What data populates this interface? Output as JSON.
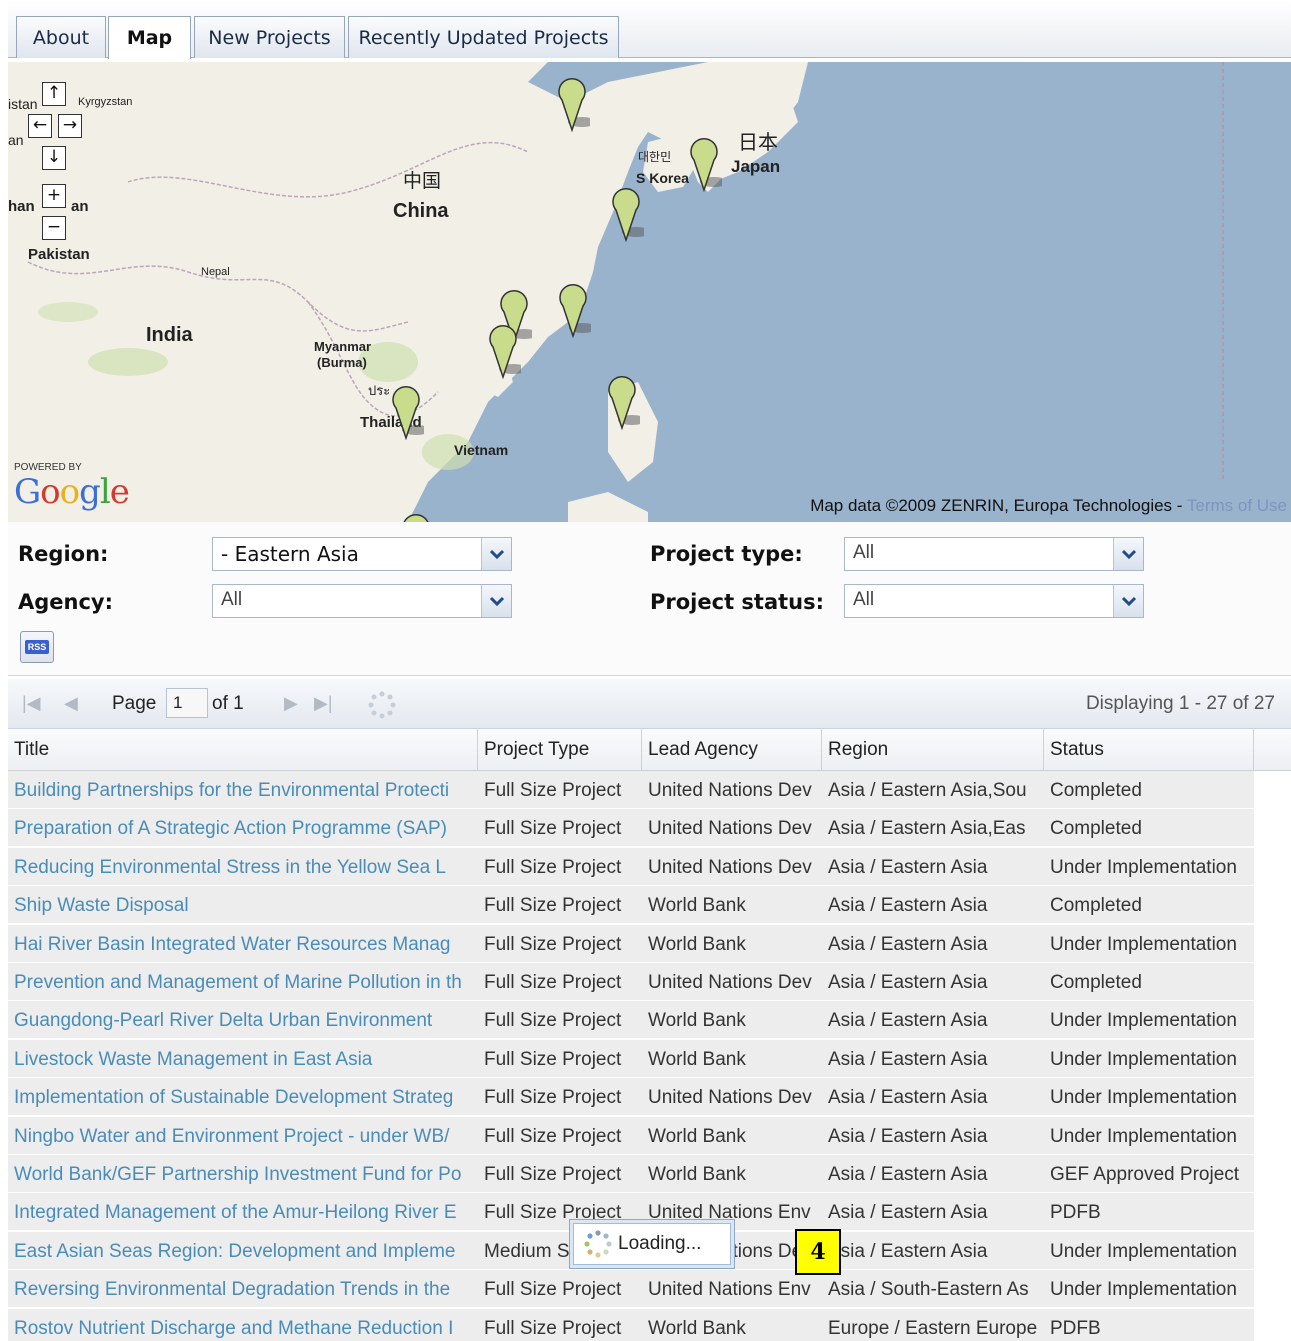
{
  "tabs": [
    {
      "label": "About"
    },
    {
      "label": "Map"
    },
    {
      "label": "New Projects"
    },
    {
      "label": "Recently Updated Projects"
    }
  ],
  "map": {
    "labels": {
      "kyrgyzstan": "Kyrgyzstan",
      "istan": "istan",
      "an": "an",
      "han_an": "han",
      "han_an2": "an",
      "pakistan": "Pakistan",
      "nepal": "Nepal",
      "india": "India",
      "china_cn": "中国",
      "china": "China",
      "korea_kr": "대한민",
      "korea": "S Korea",
      "japan_jp": "日本",
      "japan": "Japan",
      "myanmar": "Myanmar",
      "burma": "(Burma)",
      "thai_th": "ประ",
      "thailand": "Thailand",
      "vietnam": "Vietnam"
    },
    "powered_by": "POWERED BY",
    "google_logo": "Google",
    "attribution": "Map data ©2009 ZENRIN, Europa Technologies - ",
    "terms_link": "Terms of Use"
  },
  "filters": {
    "region_label": "Region:",
    "region_value": "- Eastern Asia",
    "agency_label": "Agency:",
    "agency_value": "All",
    "project_type_label": "Project type:",
    "project_type_value": "All",
    "project_status_label": "Project status:",
    "project_status_value": "All",
    "rss_label": "RSS"
  },
  "pager": {
    "page_label": "Page",
    "page_value": "1",
    "of_label": "of 1",
    "display_text": "Displaying 1 - 27 of 27"
  },
  "grid": {
    "columns": [
      "Title",
      "Project Type",
      "Lead Agency",
      "Region",
      "Status"
    ],
    "rows": [
      {
        "title": "Building Partnerships for the Environmental Protecti",
        "type": "Full Size Project",
        "agency": "United Nations Dev",
        "region": "Asia / Eastern Asia,Sou",
        "status": "Completed"
      },
      {
        "title": "Preparation of A Strategic Action Programme (SAP)",
        "type": "Full Size Project",
        "agency": "United Nations Dev",
        "region": "Asia / Eastern Asia,Eas",
        "status": "Completed"
      },
      {
        "title": "Reducing Environmental Stress in the Yellow Sea L",
        "type": "Full Size Project",
        "agency": "United Nations Dev",
        "region": "Asia / Eastern Asia",
        "status": "Under Implementation"
      },
      {
        "title": "Ship Waste Disposal",
        "type": "Full Size Project",
        "agency": "World Bank",
        "region": "Asia / Eastern Asia",
        "status": "Completed"
      },
      {
        "title": "Hai River Basin Integrated Water Resources Manag",
        "type": "Full Size Project",
        "agency": "World Bank",
        "region": "Asia / Eastern Asia",
        "status": "Under Implementation"
      },
      {
        "title": "Prevention and Management of Marine Pollution in th",
        "type": "Full Size Project",
        "agency": "United Nations Dev",
        "region": "Asia / Eastern Asia",
        "status": "Completed"
      },
      {
        "title": "Guangdong-Pearl River Delta Urban Environment",
        "type": "Full Size Project",
        "agency": "World Bank",
        "region": "Asia / Eastern Asia",
        "status": "Under Implementation"
      },
      {
        "title": "Livestock Waste Management in East Asia",
        "type": "Full Size Project",
        "agency": "World Bank",
        "region": "Asia / Eastern Asia",
        "status": "Under Implementation"
      },
      {
        "title": "Implementation of Sustainable Development Strateg",
        "type": "Full Size Project",
        "agency": "United Nations Dev",
        "region": "Asia / Eastern Asia",
        "status": "Under Implementation"
      },
      {
        "title": "Ningbo Water and Environment Project - under WB/",
        "type": "Full Size Project",
        "agency": "World Bank",
        "region": "Asia / Eastern Asia",
        "status": "Under Implementation"
      },
      {
        "title": "World Bank/GEF Partnership Investment Fund for Po",
        "type": "Full Size Project",
        "agency": "World Bank",
        "region": "Asia / Eastern Asia",
        "status": "GEF Approved Project"
      },
      {
        "title": "Integrated Management of the Amur-Heilong River E",
        "type": "Full Size Project",
        "agency": "United Nations Env",
        "region": "Asia / Eastern Asia",
        "status": "PDFB"
      },
      {
        "title": "East Asian Seas Region: Development and Impleme",
        "type": "Medium Size Project",
        "agency": "United Nations Dev",
        "region": "Asia / Eastern Asia",
        "status": "Under Implementation"
      },
      {
        "title": "Reversing Environmental Degradation Trends in the",
        "type": "Full Size Project",
        "agency": "United Nations Env",
        "region": "Asia / South-Eastern As",
        "status": "Under Implementation"
      },
      {
        "title": "Rostov Nutrient Discharge and Methane Reduction I",
        "type": "Full Size Project",
        "agency": "World Bank",
        "region": "Europe / Eastern Europe",
        "status": "PDFB"
      }
    ]
  },
  "loading_text": "Loading...",
  "annotation_number": "4",
  "colors": {
    "map_water": "#99b3cc",
    "map_land": "#f2efe7",
    "marker_fill": "#c8dc8c",
    "link": "#4a8cb8",
    "row_bg": "#ededed",
    "badge": "#ffff00"
  }
}
